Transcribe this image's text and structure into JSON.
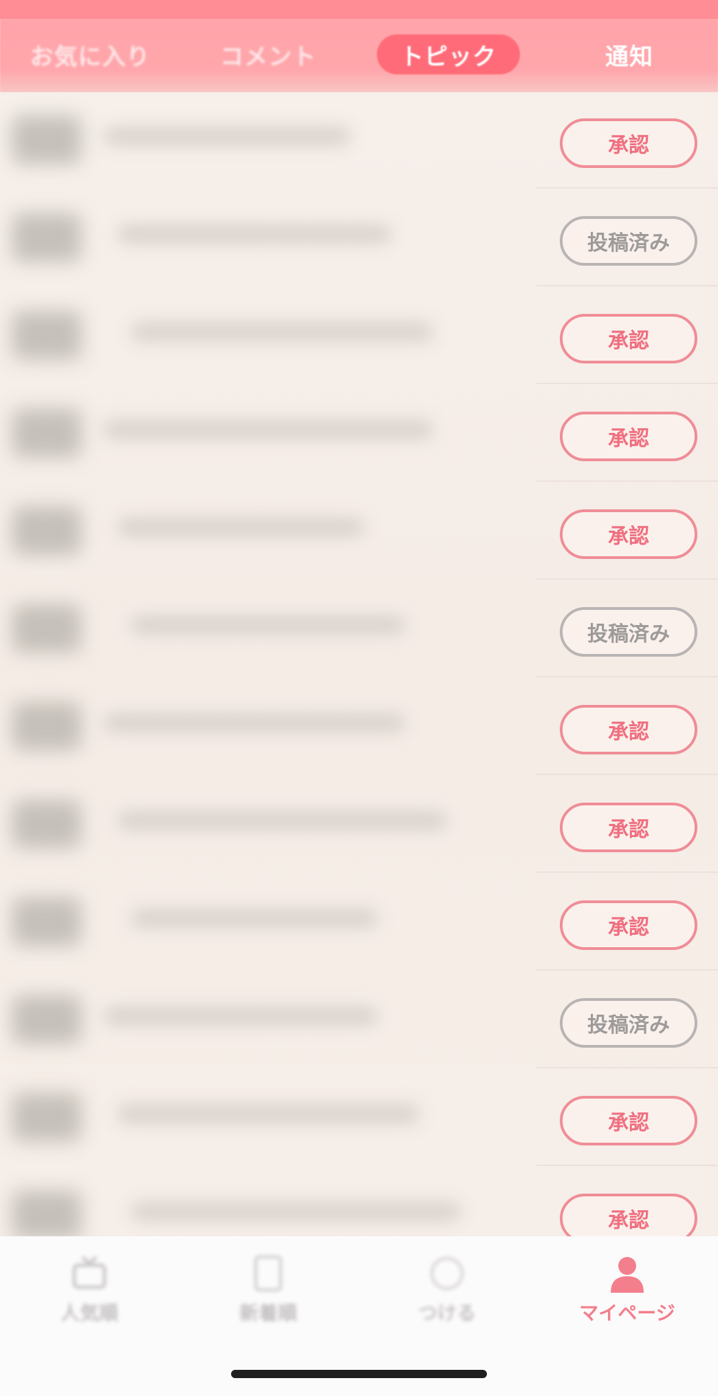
{
  "tabs": [
    {
      "label": "お気に入り",
      "active": false
    },
    {
      "label": "コメント",
      "active": false
    },
    {
      "label": "トピック",
      "active": true
    },
    {
      "label": "通知",
      "active": false
    }
  ],
  "rows": [
    {
      "action": "承認",
      "state": "approve"
    },
    {
      "action": "投稿済み",
      "state": "posted"
    },
    {
      "action": "承認",
      "state": "approve"
    },
    {
      "action": "承認",
      "state": "approve"
    },
    {
      "action": "承認",
      "state": "approve"
    },
    {
      "action": "投稿済み",
      "state": "posted"
    },
    {
      "action": "承認",
      "state": "approve"
    },
    {
      "action": "承認",
      "state": "approve"
    },
    {
      "action": "承認",
      "state": "approve"
    },
    {
      "action": "投稿済み",
      "state": "posted"
    },
    {
      "action": "承認",
      "state": "approve"
    },
    {
      "action": "承認",
      "state": "approve"
    }
  ],
  "bottom_nav": [
    {
      "label": "人気順",
      "icon": "tv-icon",
      "active": false
    },
    {
      "label": "新着順",
      "icon": "document-icon",
      "active": false
    },
    {
      "label": "つける",
      "icon": "circle-icon",
      "active": false
    },
    {
      "label": "マイページ",
      "icon": "person-icon",
      "active": true
    }
  ],
  "colors": {
    "header": "#ffa4aa",
    "active_tab": "#ff6b78",
    "approve": "#ef6f80",
    "posted": "#9d9a9a"
  }
}
